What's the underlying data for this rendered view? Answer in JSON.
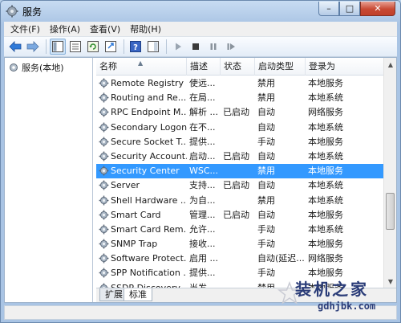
{
  "window": {
    "title": "服务"
  },
  "menu": [
    "文件(F)",
    "操作(A)",
    "查看(V)",
    "帮助(H)"
  ],
  "left_pane": {
    "node_label": "服务(本地)"
  },
  "table": {
    "columns": [
      "名称",
      "描述",
      "状态",
      "启动类型",
      "登录为"
    ],
    "rows": [
      {
        "name": "Remote Registry",
        "desc": "使远...",
        "status": "",
        "startup": "禁用",
        "logon": "本地服务"
      },
      {
        "name": "Routing and Re...",
        "desc": "在局...",
        "status": "",
        "startup": "禁用",
        "logon": "本地系统"
      },
      {
        "name": "RPC Endpoint M...",
        "desc": "解析 ...",
        "status": "已启动",
        "startup": "自动",
        "logon": "网络服务"
      },
      {
        "name": "Secondary Logon",
        "desc": "在不...",
        "status": "",
        "startup": "自动",
        "logon": "本地系统"
      },
      {
        "name": "Secure Socket T...",
        "desc": "提供...",
        "status": "",
        "startup": "手动",
        "logon": "本地服务"
      },
      {
        "name": "Security Account...",
        "desc": "启动...",
        "status": "已启动",
        "startup": "自动",
        "logon": "本地系统"
      },
      {
        "name": "Security Center",
        "desc": "WSC...",
        "status": "",
        "startup": "禁用",
        "logon": "本地服务"
      },
      {
        "name": "Server",
        "desc": "支持...",
        "status": "已启动",
        "startup": "自动",
        "logon": "本地系统"
      },
      {
        "name": "Shell Hardware ...",
        "desc": "为自...",
        "status": "",
        "startup": "禁用",
        "logon": "本地系统"
      },
      {
        "name": "Smart Card",
        "desc": "管理...",
        "status": "已启动",
        "startup": "自动",
        "logon": "本地服务"
      },
      {
        "name": "Smart Card Rem...",
        "desc": "允许...",
        "status": "",
        "startup": "手动",
        "logon": "本地系统"
      },
      {
        "name": "SNMP Trap",
        "desc": "接收...",
        "status": "",
        "startup": "手动",
        "logon": "本地服务"
      },
      {
        "name": "Software Protect...",
        "desc": "启用 ...",
        "status": "",
        "startup": "自动(延迟...",
        "logon": "网络服务"
      },
      {
        "name": "SPP Notification ...",
        "desc": "提供...",
        "status": "",
        "startup": "手动",
        "logon": "本地服务"
      },
      {
        "name": "SSDP Discovery",
        "desc": "当发...",
        "status": "",
        "startup": "禁用",
        "logon": "本地服务"
      }
    ],
    "selected_index": 6
  },
  "tabs": [
    "扩展",
    "标准"
  ],
  "selected_tab": 1,
  "watermark": {
    "text": "装机之家",
    "url": "gdhjbk.com"
  },
  "colors": {
    "selection": "#3399ff",
    "frame": "#a9c4e4"
  }
}
